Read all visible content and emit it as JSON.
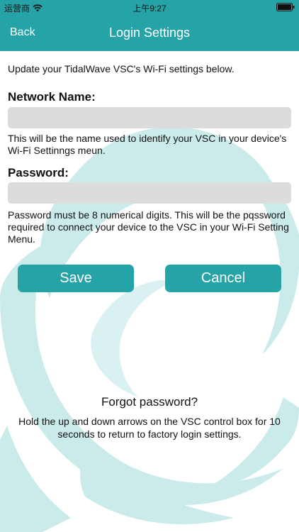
{
  "status_bar": {
    "carrier": "运营商",
    "time": "上午9:27"
  },
  "nav": {
    "back_label": "Back",
    "title": "Login Settings"
  },
  "form": {
    "intro": "Update your TidalWave VSC's Wi-Fi settings below.",
    "network": {
      "label": "Network Name:",
      "value": "",
      "help": "This will be the name used to identify your VSC in your device's Wi-Fi Settinngs meun."
    },
    "password": {
      "label": "Password:",
      "value": "",
      "help": "Password must be 8 numerical digits. This will be the pqssword required to connect your device to the VSC in your Wi-Fi Setting Menu."
    },
    "save_label": "Save",
    "cancel_label": "Cancel"
  },
  "forgot": {
    "title": "Forgot password?",
    "text": "Hold the up and down arrows on the VSC control box for 10 seconds to return to factory login settings."
  },
  "colors": {
    "accent": "#26a3a6",
    "field_bg": "#dcdcdc",
    "swirl": "#bfe6e6"
  },
  "icons": {
    "wifi": "wifi-icon",
    "battery": "battery-icon",
    "background": "wave-swirl-graphic"
  }
}
